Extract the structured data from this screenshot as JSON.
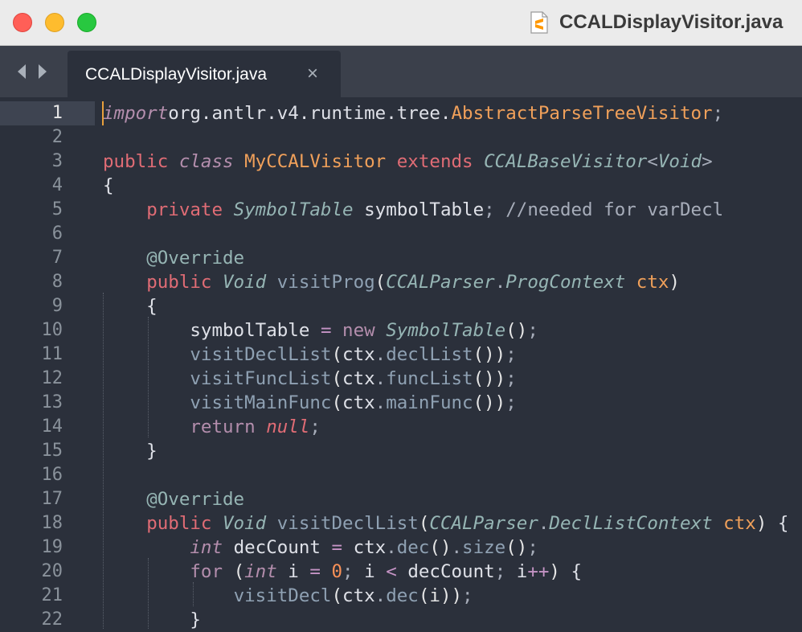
{
  "window": {
    "title": "CCALDisplayVisitor.java",
    "file_icon": "sublime-text-file-icon"
  },
  "tabs": [
    {
      "label": "CCALDisplayVisitor.java",
      "close": "×"
    }
  ],
  "editor": {
    "active_line": 1,
    "lines": [
      {
        "n": "1",
        "tokens": [
          [
            "kwi",
            "import"
          ],
          [
            "",
            "org.antlr.v4.runtime.tree."
          ],
          [
            "cls",
            "AbstractParseTreeVisitor"
          ],
          [
            "pun",
            ";"
          ]
        ]
      },
      {
        "n": "2",
        "tokens": []
      },
      {
        "n": "3",
        "tokens": [
          [
            "kw",
            "public "
          ],
          [
            "kwi",
            "class "
          ],
          [
            "cls",
            "MyCCALVisitor "
          ],
          [
            "kw",
            "extends "
          ],
          [
            "ty",
            "CCALBaseVisitor"
          ],
          [
            "pun",
            "<"
          ],
          [
            "ty",
            "Void"
          ],
          [
            "pun",
            ">"
          ]
        ]
      },
      {
        "n": "4",
        "tokens": [
          [
            "",
            "{"
          ]
        ]
      },
      {
        "n": "5",
        "tokens": [
          [
            "",
            "    "
          ],
          [
            "kw",
            "private "
          ],
          [
            "ty",
            "SymbolTable "
          ],
          [
            "",
            "symbolTable"
          ],
          [
            "pun",
            "; "
          ],
          [
            "cm",
            "//needed for varDecl"
          ]
        ]
      },
      {
        "n": "6",
        "tokens": []
      },
      {
        "n": "7",
        "tokens": [
          [
            "",
            "    "
          ],
          [
            "an",
            "@Override"
          ]
        ]
      },
      {
        "n": "8",
        "tokens": [
          [
            "",
            "    "
          ],
          [
            "kw",
            "public "
          ],
          [
            "ty",
            "Void "
          ],
          [
            "fn",
            "visitProg"
          ],
          [
            "pa",
            "("
          ],
          [
            "ty",
            "CCALParser"
          ],
          [
            "pun",
            "."
          ],
          [
            "ty",
            "ProgContext "
          ],
          [
            "ctx",
            "ctx"
          ],
          [
            "pa",
            ")"
          ]
        ]
      },
      {
        "n": "9",
        "tokens": [
          [
            "",
            "    {"
          ]
        ]
      },
      {
        "n": "10",
        "tokens": [
          [
            "",
            "        symbolTable "
          ],
          [
            "op",
            "= "
          ],
          [
            "k",
            "new "
          ],
          [
            "ty",
            "SymbolTable"
          ],
          [
            "pa",
            "()"
          ],
          [
            "pun",
            ";"
          ]
        ]
      },
      {
        "n": "11",
        "tokens": [
          [
            "",
            "        "
          ],
          [
            "fn",
            "visitDeclList"
          ],
          [
            "pa",
            "("
          ],
          [
            "",
            "ctx"
          ],
          [
            "pun",
            "."
          ],
          [
            "fn",
            "declList"
          ],
          [
            "pa",
            "())"
          ],
          [
            "pun",
            ";"
          ]
        ]
      },
      {
        "n": "12",
        "tokens": [
          [
            "",
            "        "
          ],
          [
            "fn",
            "visitFuncList"
          ],
          [
            "pa",
            "("
          ],
          [
            "",
            "ctx"
          ],
          [
            "pun",
            "."
          ],
          [
            "fn",
            "funcList"
          ],
          [
            "pa",
            "())"
          ],
          [
            "pun",
            ";"
          ]
        ]
      },
      {
        "n": "13",
        "tokens": [
          [
            "",
            "        "
          ],
          [
            "fn",
            "visitMainFunc"
          ],
          [
            "pa",
            "("
          ],
          [
            "",
            "ctx"
          ],
          [
            "pun",
            "."
          ],
          [
            "fn",
            "mainFunc"
          ],
          [
            "pa",
            "())"
          ],
          [
            "pun",
            ";"
          ]
        ]
      },
      {
        "n": "14",
        "tokens": [
          [
            "",
            "        "
          ],
          [
            "k",
            "return "
          ],
          [
            "nu",
            "null"
          ],
          [
            "pun",
            ";"
          ]
        ]
      },
      {
        "n": "15",
        "tokens": [
          [
            "",
            "    }"
          ]
        ]
      },
      {
        "n": "16",
        "tokens": []
      },
      {
        "n": "17",
        "tokens": [
          [
            "",
            "    "
          ],
          [
            "an",
            "@Override"
          ]
        ]
      },
      {
        "n": "18",
        "tokens": [
          [
            "",
            "    "
          ],
          [
            "kw",
            "public "
          ],
          [
            "ty",
            "Void "
          ],
          [
            "fn",
            "visitDeclList"
          ],
          [
            "pa",
            "("
          ],
          [
            "ty",
            "CCALParser"
          ],
          [
            "pun",
            "."
          ],
          [
            "ty",
            "DeclListContext "
          ],
          [
            "ctx",
            "ctx"
          ],
          [
            "pa",
            ") "
          ],
          [
            "",
            "{"
          ]
        ]
      },
      {
        "n": "19",
        "tokens": [
          [
            "",
            "        "
          ],
          [
            "kwi",
            "int "
          ],
          [
            "",
            "decCount "
          ],
          [
            "op",
            "= "
          ],
          [
            "",
            "ctx"
          ],
          [
            "pun",
            "."
          ],
          [
            "fn",
            "dec"
          ],
          [
            "pa",
            "()"
          ],
          [
            "pun",
            "."
          ],
          [
            "fn",
            "size"
          ],
          [
            "pa",
            "()"
          ],
          [
            "pun",
            ";"
          ]
        ]
      },
      {
        "n": "20",
        "tokens": [
          [
            "",
            "        "
          ],
          [
            "k",
            "for "
          ],
          [
            "pa",
            "("
          ],
          [
            "kwi",
            "int "
          ],
          [
            "",
            "i "
          ],
          [
            "op",
            "= "
          ],
          [
            "num",
            "0"
          ],
          [
            "pun",
            "; "
          ],
          [
            "",
            "i "
          ],
          [
            "op",
            "< "
          ],
          [
            "",
            "decCount"
          ],
          [
            "pun",
            "; "
          ],
          [
            "",
            "i"
          ],
          [
            "op",
            "++"
          ],
          [
            "pa",
            ") "
          ],
          [
            "",
            "{"
          ]
        ]
      },
      {
        "n": "21",
        "tokens": [
          [
            "",
            "            "
          ],
          [
            "fn",
            "visitDecl"
          ],
          [
            "pa",
            "("
          ],
          [
            "",
            "ctx"
          ],
          [
            "pun",
            "."
          ],
          [
            "fn",
            "dec"
          ],
          [
            "pa",
            "(i))"
          ],
          [
            "pun",
            ";"
          ]
        ]
      },
      {
        "n": "22",
        "tokens": [
          [
            "",
            "        }"
          ]
        ]
      }
    ]
  }
}
